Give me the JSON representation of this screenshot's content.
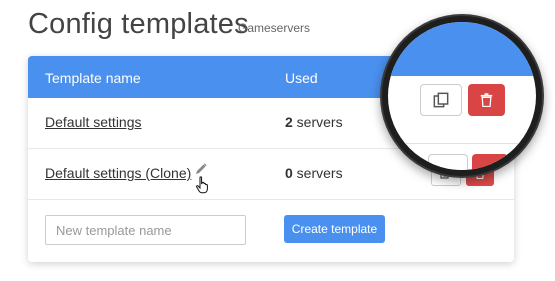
{
  "header": {
    "title": "Config templates",
    "subtitle": "Gameservers"
  },
  "table": {
    "columns": [
      "Template name",
      "Used"
    ],
    "rows": [
      {
        "name": "Default settings",
        "count": "2",
        "count_suffix": " servers"
      },
      {
        "name": "Default settings (Clone)",
        "count": "0",
        "count_suffix": " servers"
      }
    ]
  },
  "new_template": {
    "placeholder": "New template name",
    "value": "",
    "create_label": "Create template"
  },
  "icons": {
    "edit": "pencil-icon",
    "clone": "clone-icon",
    "delete": "trash-icon",
    "cursor": "hand-pointer-icon"
  },
  "colors": {
    "accent": "#4a90ee",
    "danger": "#dc4a4a"
  }
}
